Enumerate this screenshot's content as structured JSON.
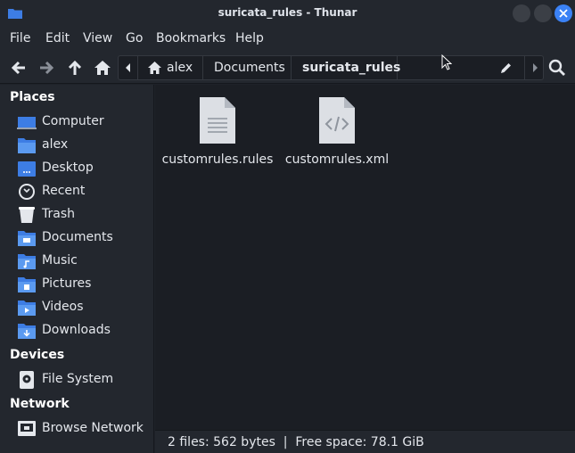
{
  "window": {
    "title": "suricata_rules - Thunar"
  },
  "menu": [
    "File",
    "Edit",
    "View",
    "Go",
    "Bookmarks",
    "Help"
  ],
  "path": {
    "home": "alex",
    "seg2": "Documents",
    "current": "suricata_rules"
  },
  "sidebar": {
    "places_title": "Places",
    "places": [
      "Computer",
      "alex",
      "Desktop",
      "Recent",
      "Trash",
      "Documents",
      "Music",
      "Pictures",
      "Videos",
      "Downloads"
    ],
    "devices_title": "Devices",
    "devices": [
      "File System"
    ],
    "network_title": "Network",
    "network": [
      "Browse Network"
    ]
  },
  "files": [
    {
      "name": "customrules.rules",
      "icon": "text-file-icon"
    },
    {
      "name": "customrules.xml",
      "icon": "xml-file-icon"
    }
  ],
  "status": "2 files: 562 bytes  |  Free space: 78.1 GiB",
  "colors": {
    "accent": "#3b82f6",
    "folder": "#3d7de4",
    "bg": "#1b1e24",
    "panel": "#23272e"
  }
}
